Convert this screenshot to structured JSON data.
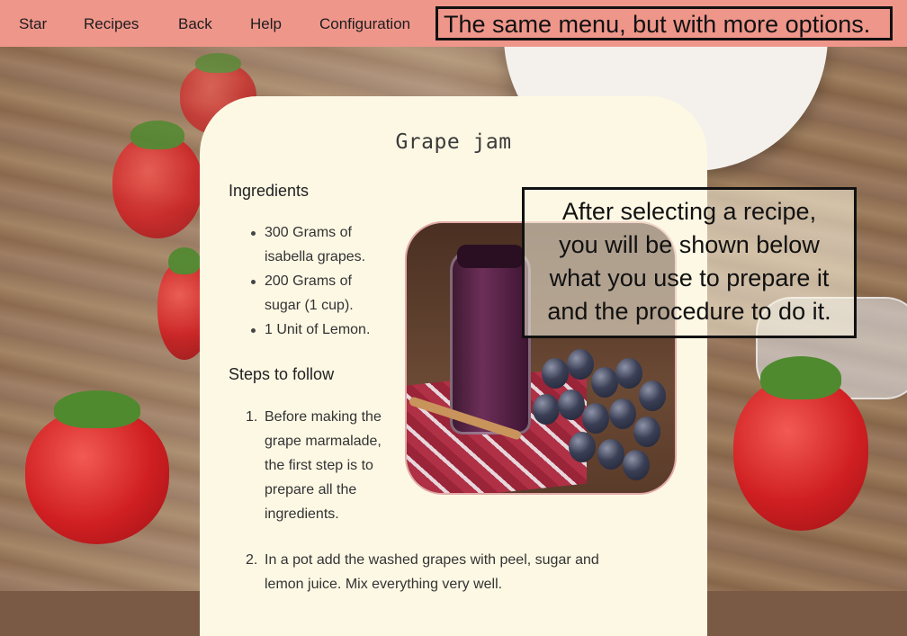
{
  "nav": {
    "items": [
      "Star",
      "Recipes",
      "Back",
      "Help",
      "Configuration"
    ],
    "note": "The same menu, but with more options."
  },
  "recipe": {
    "title": "Grape jam",
    "ingredients_heading": "Ingredients",
    "ingredients": [
      [
        "300 Grams of",
        "isabella grapes."
      ],
      [
        "200 Grams of",
        "sugar (1 cup)."
      ],
      [
        "1 Unit of Lemon."
      ]
    ],
    "steps_heading": "Steps to follow",
    "steps": [
      {
        "number": "1.",
        "lines": [
          "Before making the",
          "grape marmalade,",
          "the first step is to",
          "prepare all the",
          "ingredients."
        ]
      },
      {
        "number": "2.",
        "lines": [
          "In a pot add the washed grapes with peel, sugar and",
          "lemon juice. Mix everything very well."
        ]
      }
    ]
  },
  "annotation": {
    "lines": [
      "After selecting a recipe,",
      "you will be shown below",
      "what you use to prepare it",
      "and the procedure to do it."
    ]
  },
  "colors": {
    "nav_bg": "#ef968b",
    "card_bg": "#fdf8e4",
    "photo_border": "#e2aaa8"
  }
}
